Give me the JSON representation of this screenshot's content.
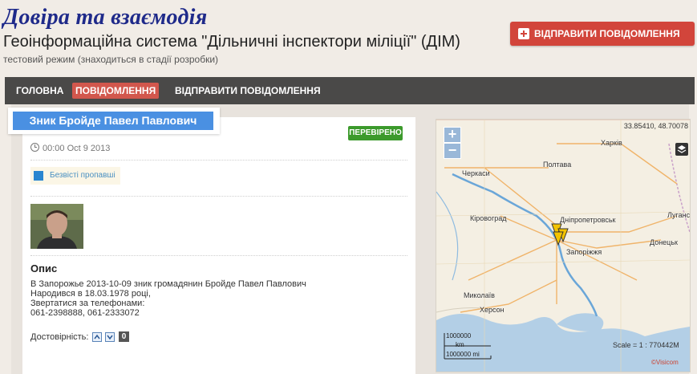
{
  "header": {
    "brand": "Довіра та взаємодія",
    "subtitle": "Геоінформаційна система \"Дільничні інспектори міліції\" (ДІМ)",
    "test_mode": "тестовий режим (знаходиться в стадії розробки)",
    "send_button": "ВІДПРАВИТИ ПОВІДОМЛЕННЯ",
    "send_icon": "plus-icon"
  },
  "nav": {
    "items": [
      {
        "label": "ГОЛОВНА",
        "active": false
      },
      {
        "label": "ПОВІДОМЛЕННЯ",
        "active": true
      },
      {
        "label": "ВІДПРАВИТИ ПОВІДОМЛЕННЯ",
        "active": false
      }
    ]
  },
  "report": {
    "name": "Зник Бройде Павел Павлович",
    "status": "ПЕРЕВІРЕНО",
    "timestamp": "00:00 Oct 9 2013",
    "category": "Безвісті пропавші",
    "description_title": "Опис",
    "description_lines": [
      "В Запорожье 2013-10-09 зник громадянин Бройде Павел Павлович",
      "Народився в 18.03.1978 році,",
      "Звертатися за телефонами:",
      "061-2398888, 061-2333072"
    ],
    "reliability_label": "Достовірність:",
    "reliability_score": "0"
  },
  "map": {
    "coords": "33.85410, 48.70078",
    "zoom_in": "+",
    "zoom_out": "−",
    "cities": [
      {
        "name": "Харків"
      },
      {
        "name": "Полтава"
      },
      {
        "name": "Черкаси"
      },
      {
        "name": "Кіровоград"
      },
      {
        "name": "Дніпропетровськ"
      },
      {
        "name": "Луганськ"
      },
      {
        "name": "Донецьк"
      },
      {
        "name": "Запоріжжя"
      },
      {
        "name": "Миколаїв"
      },
      {
        "name": "Херсон"
      }
    ],
    "scale_km": "1000000",
    "scale_km_unit": "km",
    "scale_mi": "1000000 mi",
    "scale_text": "Scale = 1 : 770442M",
    "copyright": "©Visicom",
    "colors": {
      "water": "#b3cfe6",
      "land": "#f4efe3",
      "marker": "#f3c300"
    }
  }
}
